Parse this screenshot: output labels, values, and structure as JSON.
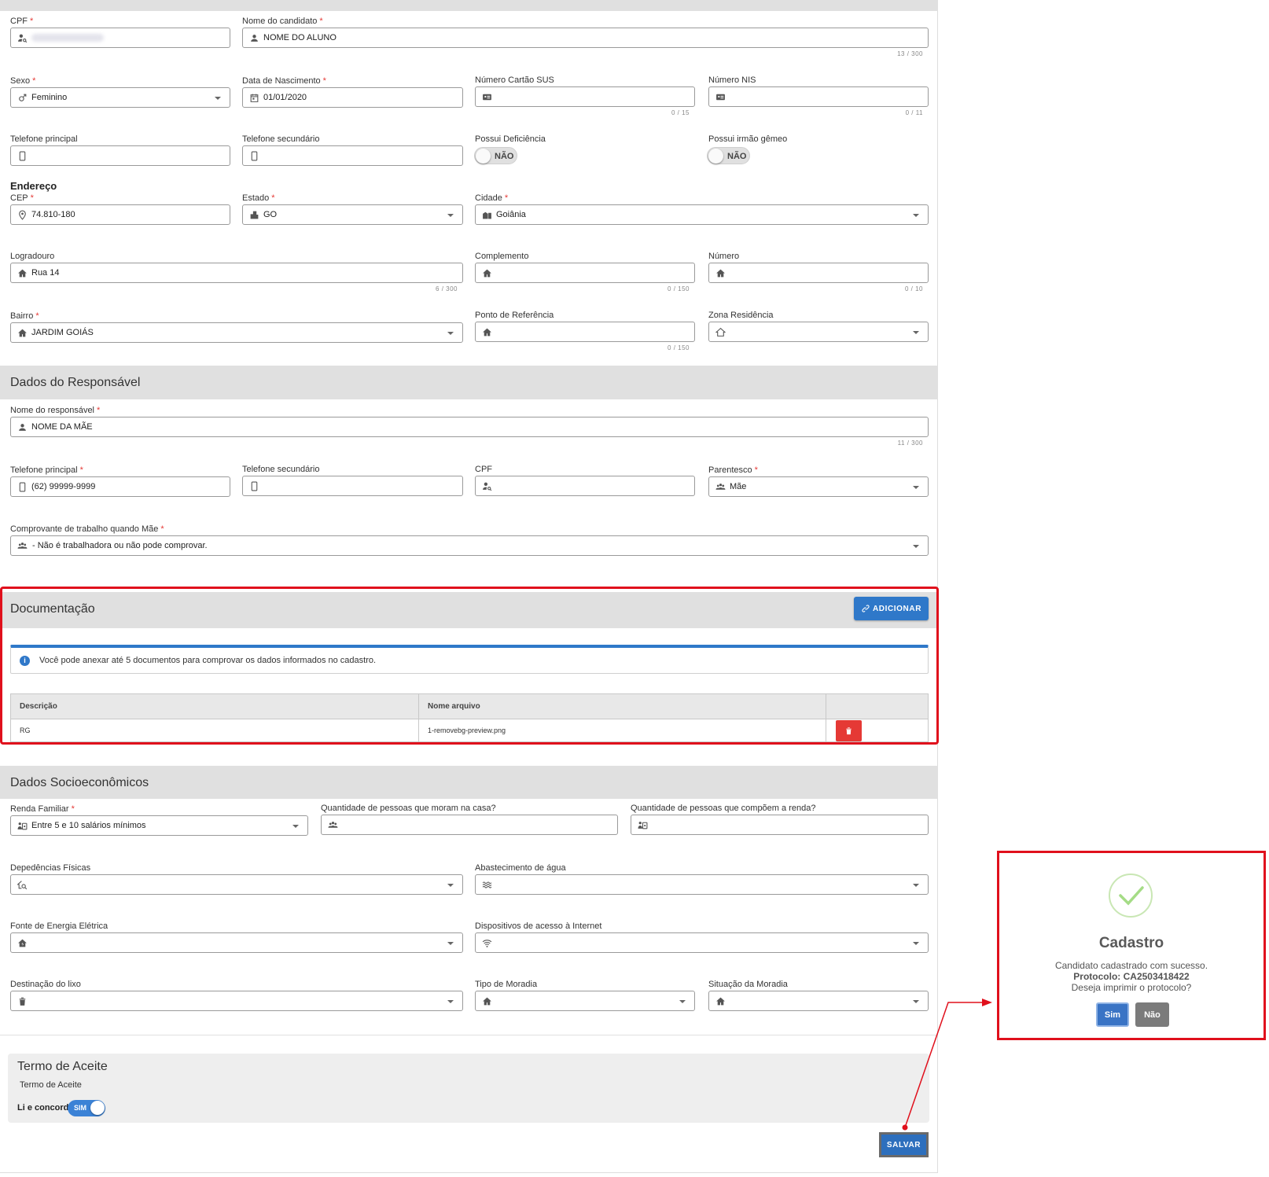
{
  "student": {
    "cpf_label": "CPF",
    "nome_label": "Nome do candidato",
    "nome_value": "NOME DO ALUNO",
    "nome_counter": "13 / 300",
    "sexo_label": "Sexo",
    "sexo_value": "Feminino",
    "nasc_label": "Data de Nascimento",
    "nasc_value": "01/01/2020",
    "sus_label": "Número Cartão SUS",
    "sus_counter": "0 / 15",
    "nis_label": "Número NIS",
    "nis_counter": "0 / 11",
    "tel1_label": "Telefone principal",
    "tel2_label": "Telefone secundário",
    "deficiencia_label": "Possui Deficiência",
    "deficiencia_value": "NÃO",
    "gemeo_label": "Possui irmão gêmeo",
    "gemeo_value": "NÃO"
  },
  "endereco": {
    "title": "Endereço",
    "cep_label": "CEP",
    "cep_value": "74.810-180",
    "estado_label": "Estado",
    "estado_value": "GO",
    "cidade_label": "Cidade",
    "cidade_value": "Goiânia",
    "logradouro_label": "Logradouro",
    "logradouro_value": "Rua 14",
    "logradouro_counter": "6 / 300",
    "complemento_label": "Complemento",
    "complemento_counter": "0 / 150",
    "numero_label": "Número",
    "numero_counter": "0 / 10",
    "bairro_label": "Bairro",
    "bairro_value": "JARDIM GOIÁS",
    "referencia_label": "Ponto de Referência",
    "referencia_counter": "0 / 150",
    "zona_label": "Zona Residência"
  },
  "responsavel": {
    "title": "Dados do Responsável",
    "nome_label": "Nome do responsável",
    "nome_value": "NOME DA MÃE",
    "nome_counter": "11 / 300",
    "tel1_label": "Telefone principal",
    "tel1_value": "(62) 99999-9999",
    "tel2_label": "Telefone secundário",
    "cpf_label": "CPF",
    "parentesco_label": "Parentesco",
    "parentesco_value": "Mãe",
    "comprovante_label": "Comprovante de trabalho quando Mãe",
    "comprovante_value": "- Não é trabalhadora ou não pode comprovar."
  },
  "documentacao": {
    "title": "Documentação",
    "add_label": "ADICIONAR",
    "info_text": "Você pode anexar até 5 documentos para comprovar os dados informados no cadastro.",
    "col_descricao": "Descrição",
    "col_arquivo": "Nome arquivo",
    "row_descricao": "RG",
    "row_arquivo": "1-removebg-preview.png"
  },
  "socio": {
    "title": "Dados Socioeconômicos",
    "renda_label": "Renda Familiar",
    "renda_value": "Entre 5 e 10 salários mínimos",
    "qtd_casa_label": "Quantidade de pessoas que moram na casa?",
    "qtd_renda_label": "Quantidade de pessoas que compõem a renda?",
    "dependencias_label": "Depedências Físicas",
    "agua_label": "Abastecimento de água",
    "energia_label": "Fonte de Energia Elétrica",
    "internet_label": "Dispositivos de acesso à Internet",
    "lixo_label": "Destinação do lixo",
    "moradia_label": "Tipo de Moradia",
    "situacao_label": "Situação da Moradia"
  },
  "termo": {
    "title": "Termo de Aceite",
    "subtitle": "Termo de Aceite",
    "concordo_label": "Li e concordo",
    "toggle_value": "SIM"
  },
  "save_label": "SALVAR",
  "modal": {
    "title": "Cadastro",
    "message": "Candidato cadastrado com sucesso.",
    "protocolo": "Protocolo: CA2503418422",
    "question": "Deseja imprimir o protocolo?",
    "yes_label": "Sim",
    "no_label": "Não"
  },
  "colors": {
    "accent": "#2f78c9",
    "highlight": "#e0101c",
    "danger": "#e53935",
    "success": "#a5dc86"
  }
}
